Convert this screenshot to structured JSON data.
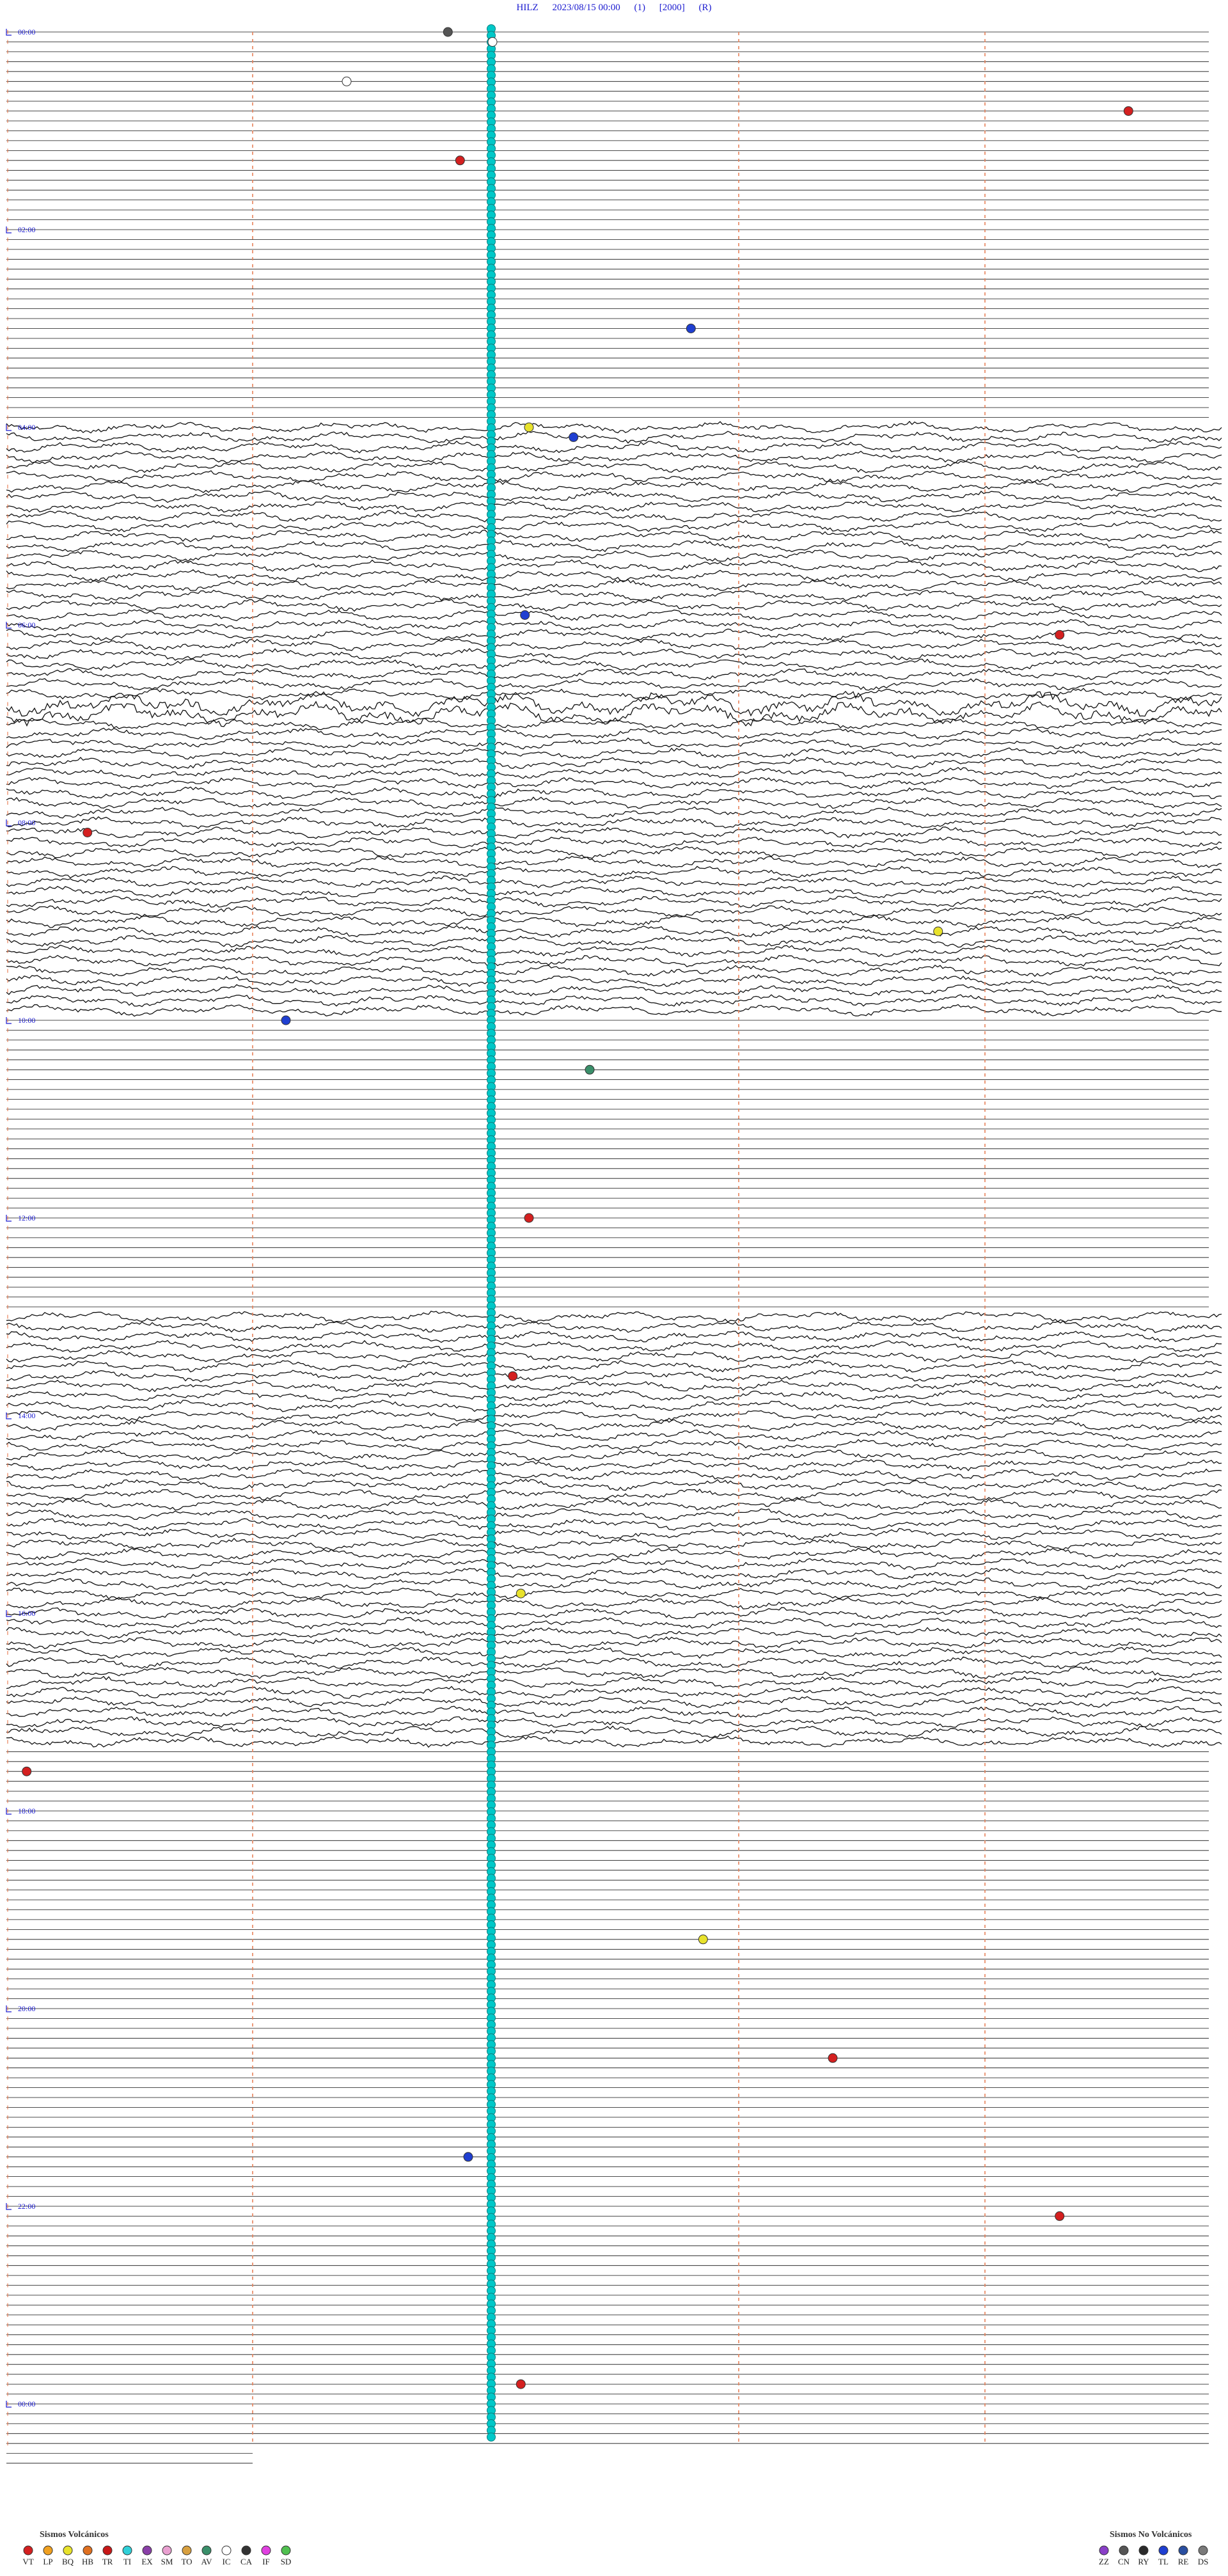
{
  "header": {
    "station": "HILZ",
    "datetime": "2023/08/15 00:00",
    "channel": "(1)",
    "gain": "[2000]",
    "flag": "(R)"
  },
  "chart_data": {
    "type": "helicorder",
    "station": "HILZ",
    "date": "2023/08/15",
    "hour_labels": [
      "00:00",
      "02:00",
      "04:00",
      "06:00",
      "08:00",
      "10:00",
      "12:00",
      "14:00",
      "16:00",
      "18:00",
      "20:00",
      "22:00",
      "00:00"
    ],
    "lines_per_hour": 10,
    "trace_count": 245,
    "noisy_segments": [
      {
        "start_time": "04:00",
        "end_time": "10:00",
        "level": "high"
      },
      {
        "start_time": "13:00",
        "end_time": "17:20",
        "level": "high"
      }
    ],
    "marker_columns": [
      {
        "color": "#00c8c8",
        "time_in_row": "3.0 min"
      }
    ],
    "event_markers": [
      {
        "time": "00:02",
        "type": "CA",
        "color": "#555555"
      },
      {
        "time": "00:06",
        "type": "IC",
        "color": "#ffffff"
      },
      {
        "time": "00:30",
        "type": "IC",
        "color": "#ffffff"
      },
      {
        "time": "00:50",
        "type": "VT",
        "color": "#d42020"
      },
      {
        "time": "01:20",
        "type": "VT",
        "color": "#d42020"
      },
      {
        "time": "03:05",
        "type": "TL",
        "color": "#1f3fd1"
      },
      {
        "time": "04:00",
        "type": "BQ",
        "color": "#e8e22c"
      },
      {
        "time": "04:10",
        "type": "TL",
        "color": "#1f3fd1"
      },
      {
        "time": "05:55",
        "type": "TL",
        "color": "#1f3fd1"
      },
      {
        "time": "06:10",
        "type": "VT",
        "color": "#d42020"
      },
      {
        "time": "08:10",
        "type": "VT",
        "color": "#d42020"
      },
      {
        "time": "09:10",
        "type": "BQ",
        "color": "#e8e22c"
      },
      {
        "time": "10:00",
        "type": "TL",
        "color": "#1f3fd1"
      },
      {
        "time": "10:30",
        "type": "AV",
        "color": "#3a8f6a"
      },
      {
        "time": "12:00",
        "type": "VT",
        "color": "#d42020"
      },
      {
        "time": "13:40",
        "type": "VT",
        "color": "#d42020"
      },
      {
        "time": "15:50",
        "type": "BQ",
        "color": "#e8e22c"
      },
      {
        "time": "17:40",
        "type": "VT",
        "color": "#d42020"
      },
      {
        "time": "19:20",
        "type": "BQ",
        "color": "#e8e22c"
      },
      {
        "time": "20:30",
        "type": "VT",
        "color": "#d42020"
      },
      {
        "time": "21:30",
        "type": "TL",
        "color": "#1f3fd1"
      },
      {
        "time": "22:10",
        "type": "VT",
        "color": "#d42020"
      },
      {
        "time": "23:50",
        "type": "VT",
        "color": "#d42020"
      }
    ]
  },
  "legend": {
    "volcanic": {
      "title": "Sismos Volcánicos",
      "items": [
        {
          "code": "VT",
          "color": "#d42020"
        },
        {
          "code": "LP",
          "color": "#f0a020"
        },
        {
          "code": "BQ",
          "color": "#e8e22c"
        },
        {
          "code": "HB",
          "color": "#e07020"
        },
        {
          "code": "TR",
          "color": "#c81818"
        },
        {
          "code": "TI",
          "color": "#30d0d8"
        },
        {
          "code": "EX",
          "color": "#8a3fa8"
        },
        {
          "code": "SM",
          "color": "#e9a0d0"
        },
        {
          "code": "TO",
          "color": "#d8a040"
        },
        {
          "code": "AV",
          "color": "#3a8f6a"
        },
        {
          "code": "IC",
          "color": "#ffffff"
        },
        {
          "code": "CA",
          "color": "#333333"
        },
        {
          "code": "IF",
          "color": "#e040e0"
        },
        {
          "code": "SD",
          "color": "#50c050"
        }
      ]
    },
    "non_volcanic": {
      "title": "Sismos No Volcánicos",
      "items": [
        {
          "code": "ZZ",
          "color": "#8a3fc8"
        },
        {
          "code": "CN",
          "color": "#555555"
        },
        {
          "code": "RY",
          "color": "#2a2a2a"
        },
        {
          "code": "TL",
          "color": "#1f3fd1"
        },
        {
          "code": "RE",
          "color": "#2a4fa0"
        },
        {
          "code": "DS",
          "color": "#7a7a7a"
        }
      ]
    }
  }
}
